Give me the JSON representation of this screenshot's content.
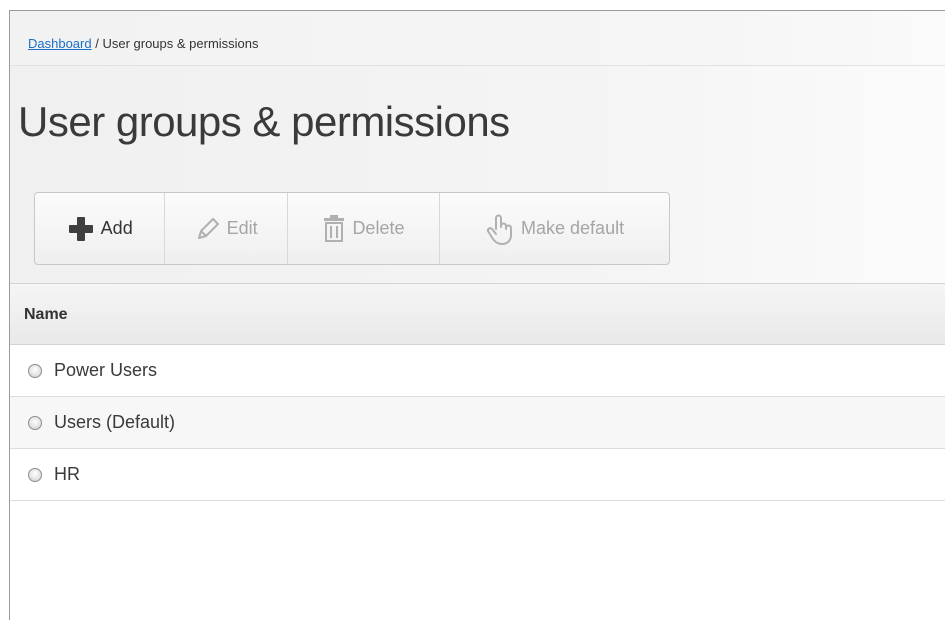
{
  "breadcrumb": {
    "link": "Dashboard",
    "separator": " / ",
    "current": "User groups & permissions"
  },
  "page": {
    "title": "User groups & permissions"
  },
  "toolbar": {
    "add_label": "Add",
    "edit_label": "Edit",
    "delete_label": "Delete",
    "make_default_label": "Make default"
  },
  "table": {
    "column_name": "Name",
    "rows": [
      {
        "label": "Power Users"
      },
      {
        "label": "Users (Default)"
      },
      {
        "label": "HR"
      }
    ]
  },
  "colors": {
    "link": "#1a6fc9",
    "text": "#3a3a3a",
    "disabled": "#a5a5a5"
  },
  "icons": {
    "add": "plus-icon",
    "edit": "pencil-icon",
    "delete": "trash-icon",
    "make_default": "hand-pointer-icon"
  }
}
